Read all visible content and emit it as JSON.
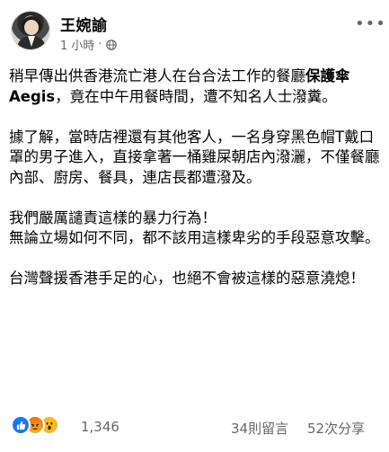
{
  "post": {
    "author": "王婉諭",
    "timestamp": "1 小時",
    "separator": "·",
    "privacy_icon": "globe-icon",
    "more_icon": "more-options-icon",
    "paragraphs": {
      "p1_before": "稍早傳出供香港流亡港人在台合法工作的餐廳",
      "p1_bold": "保護傘 Aegis",
      "p1_after": "，竟在中午用餐時間，遭不知名人士潑糞。",
      "p2": "據了解，當時店裡還有其他客人，一名身穿黑色帽T戴口罩的男子進入，直接拿著一桶雞屎朝店內潑灑，不僅餐廳內部、廚房、餐具，連店長都遭潑及。",
      "p3": "我們嚴厲譴責這樣的暴力行為！\n無論立場如何不同，都不該用這樣卑劣的手段惡意攻擊。",
      "p4": "台灣聲援香港手足的心，也絕不會被這樣的惡意澆熄！"
    },
    "stats": {
      "reactions": [
        "like-icon",
        "angry-icon",
        "wow-icon"
      ],
      "reaction_count": "1,346",
      "comments": "34則留言",
      "shares": "52次分享"
    }
  },
  "colors": {
    "text": "#050505",
    "secondary": "#65676b",
    "like_blue": "#1877f2"
  }
}
